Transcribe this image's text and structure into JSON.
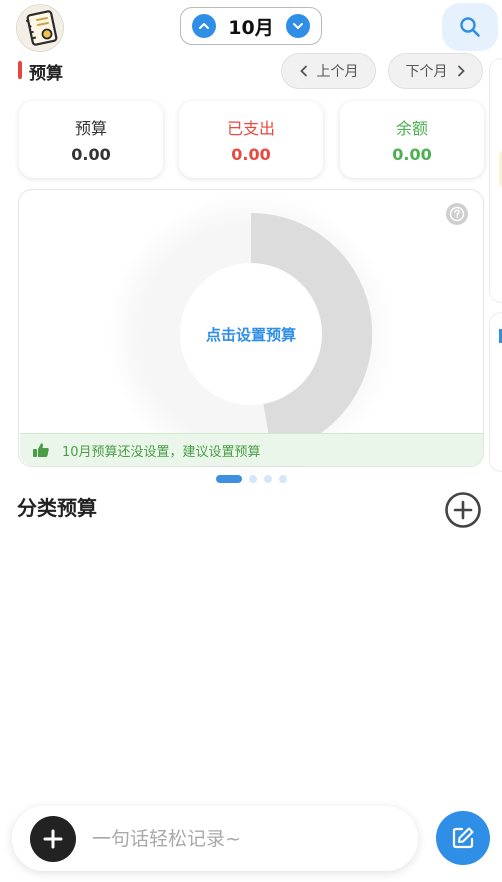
{
  "header": {
    "month": "10月",
    "prev_icon": "chevron-up-icon",
    "next_icon": "chevron-down-icon",
    "search_icon": "search-icon",
    "avatar_icon": "notebook-icon"
  },
  "budget_section": {
    "title": "预算",
    "prev_month": "上个月",
    "next_month": "下个月",
    "cards": [
      {
        "label": "预算",
        "value": "0.00",
        "color": "#333333"
      },
      {
        "label": "已支出",
        "value": "0.00",
        "color": "#e84a3f"
      },
      {
        "label": "余额",
        "value": "0.00",
        "color": "#4caf50"
      }
    ],
    "chart_center_label": "点击设置预算",
    "tip_text": "10月预算还没设置，建议设置预算",
    "tip_icon": "thumbs-up-icon",
    "help_icon": "question-icon"
  },
  "pager": {
    "pages": 4,
    "active": 0
  },
  "category_budget": {
    "title": "分类预算",
    "add_icon": "plus-circle-icon"
  },
  "quick_record": {
    "placeholder": "一句话轻松记录~",
    "add_icon": "plus-icon",
    "edit_icon": "edit-icon"
  },
  "colors": {
    "accent": "#2f8ee6",
    "danger": "#e84a3f",
    "success": "#4caf50",
    "donut_fill": "#dcdcdc"
  }
}
